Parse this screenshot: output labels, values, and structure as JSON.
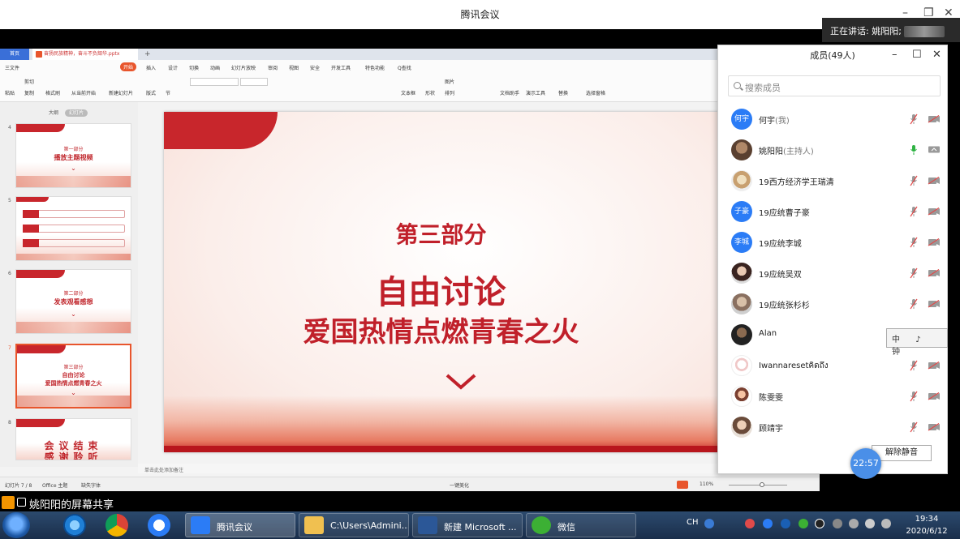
{
  "window": {
    "title": "腾讯会议",
    "speaking_label": "正在讲话: 姚阳阳;"
  },
  "wps": {
    "home_tab": "首页",
    "doc_tab": "奋扬民族精神，奋斗不负韶华.pptx",
    "menu": [
      "三文件",
      "开始",
      "插入",
      "设计",
      "切换",
      "动画",
      "幻灯片放映",
      "审阅",
      "视图",
      "安全",
      "开发工具",
      "特色功能",
      "Q查找"
    ],
    "ribbon": [
      "粘贴",
      "剪切",
      "复制",
      "格式刷",
      "从当前开始",
      "新建幻灯片",
      "版式",
      "节",
      "文本框",
      "形状",
      "图片",
      "排列",
      "文档助手",
      "演示工具",
      "替换",
      "选择窗格"
    ],
    "view_tabs": [
      "大纲",
      "幻灯片"
    ],
    "thumbs": [
      {
        "num": "4",
        "line1": "第一部分",
        "line2": "播放主题视频"
      },
      {
        "num": "5",
        "line1": "",
        "line2": ""
      },
      {
        "num": "6",
        "line1": "第二部分",
        "line2": "发表观看感想"
      },
      {
        "num": "7",
        "line1": "第三部分",
        "line2": "自由讨论",
        "line3": "爱国热情点燃青春之火"
      },
      {
        "num": "8",
        "line1": "会议结束",
        "line2": "感谢聆听"
      }
    ],
    "slide": {
      "subtitle": "第三部分",
      "title1": "自由讨论",
      "title2": "爱国热情点燃青春之火"
    },
    "notes_placeholder": "单击此处添加备注",
    "status": {
      "slide_pos": "幻灯片 7 / 8",
      "theme": "Office 主题",
      "font_missing": "缺失字体",
      "beautify": "一键美化",
      "zoom": "110%"
    }
  },
  "members": {
    "title": "成员(49人)",
    "search_placeholder": "搜索成员",
    "list": [
      {
        "name": "何宇",
        "role": "(我)",
        "avatar_text": "何宇",
        "avatar": "blue",
        "mic": "muted",
        "cam": "off"
      },
      {
        "name": "姚阳阳",
        "role": "(主持人)",
        "avatar_text": "",
        "avatar": "ph1",
        "mic": "on",
        "cam": "share"
      },
      {
        "name": "19西方经济学王瑞清",
        "role": "",
        "avatar_text": "",
        "avatar": "ph2",
        "mic": "muted",
        "cam": "off"
      },
      {
        "name": "19应统曹子豪",
        "role": "",
        "avatar_text": "子豪",
        "avatar": "blue",
        "mic": "muted",
        "cam": "off"
      },
      {
        "name": "19应统李城",
        "role": "",
        "avatar_text": "李城",
        "avatar": "blue",
        "mic": "muted",
        "cam": "off"
      },
      {
        "name": "19应统吴双",
        "role": "",
        "avatar_text": "",
        "avatar": "ph3",
        "mic": "muted",
        "cam": "off"
      },
      {
        "name": "19应统张杉杉",
        "role": "",
        "avatar_text": "",
        "avatar": "ph4",
        "mic": "muted",
        "cam": "off"
      },
      {
        "name": "Alan",
        "role": "",
        "avatar_text": "",
        "avatar": "ph5",
        "mic": "muted",
        "cam": "off"
      },
      {
        "name": "Iwannaresetคิดถึง",
        "role": "",
        "avatar_text": "",
        "avatar": "ph6",
        "mic": "muted",
        "cam": "off"
      },
      {
        "name": "陈雯雯",
        "role": "",
        "avatar_text": "",
        "avatar": "ph7",
        "mic": "muted",
        "cam": "off"
      },
      {
        "name": "顾靖宇",
        "role": "",
        "avatar_text": "",
        "avatar": "ph8",
        "mic": "muted",
        "cam": "off"
      }
    ],
    "unmute_label": "解除静音",
    "timer": "22:57"
  },
  "ime": {
    "text": "中 ♪ 钟"
  },
  "share_bar": {
    "label": "姚阳阳的屏幕共享"
  },
  "taskbar": {
    "tasks": [
      "腾讯会议",
      "C:\\Users\\Admini...",
      "新建 Microsoft ...",
      "微信"
    ],
    "tray_text": "CH",
    "time": "19:34",
    "date": "2020/6/12"
  },
  "colors": {
    "accent_red": "#c0202a",
    "wps_orange": "#e8552c",
    "tencent_blue": "#2b7cf6"
  }
}
